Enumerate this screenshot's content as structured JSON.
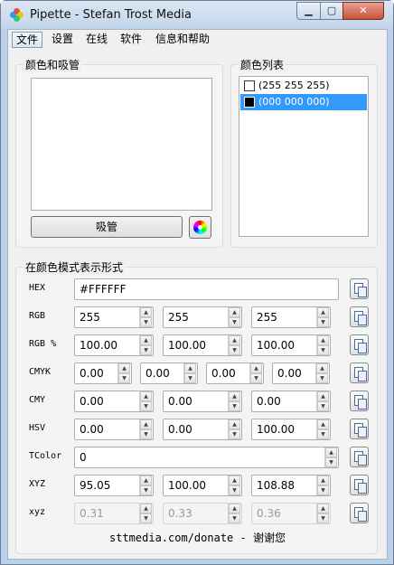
{
  "window": {
    "title": "Pipette - Stefan Trost Media",
    "minimize_glyph": "▁",
    "maximize_glyph": "▢",
    "close_glyph": "✕"
  },
  "menu": [
    "文件",
    "设置",
    "在线",
    "软件",
    "信息和帮助"
  ],
  "picker_group": {
    "title": "颜色和吸管",
    "pick_button": "吸管",
    "preview_color": "#FFFFFF"
  },
  "list_group": {
    "title": "颜色列表",
    "items": [
      {
        "label": "(255 255 255)",
        "color": "#FFFFFF",
        "selected": false
      },
      {
        "label": "(000 000 000)",
        "color": "#000000",
        "selected": true
      }
    ]
  },
  "formats_group": {
    "title": "在颜色模式表示形式",
    "rows": [
      {
        "label": "HEX",
        "values": [
          "#FFFFFF"
        ]
      },
      {
        "label": "RGB",
        "values": [
          "255",
          "255",
          "255"
        ]
      },
      {
        "label": "RGB %",
        "values": [
          "100.00",
          "100.00",
          "100.00"
        ]
      },
      {
        "label": "CMYK",
        "values": [
          "0.00",
          "0.00",
          "0.00",
          "0.00"
        ]
      },
      {
        "label": "CMY",
        "values": [
          "0.00",
          "0.00",
          "0.00"
        ]
      },
      {
        "label": "HSV",
        "values": [
          "0.00",
          "0.00",
          "100.00"
        ]
      },
      {
        "label": "TColor",
        "values": [
          "0"
        ]
      },
      {
        "label": "XYZ",
        "values": [
          "95.05",
          "100.00",
          "108.88"
        ]
      },
      {
        "label": "xyz",
        "values": [
          "0.31",
          "0.33",
          "0.36"
        ],
        "disabled": true
      }
    ]
  },
  "footer": {
    "url": "sttmedia.com/donate",
    "separator": " - ",
    "thanks": "谢谢您"
  },
  "colors": {
    "selection": "#3399FF",
    "titlebar": "#C4D6EA",
    "close_button": "#C7523A"
  }
}
